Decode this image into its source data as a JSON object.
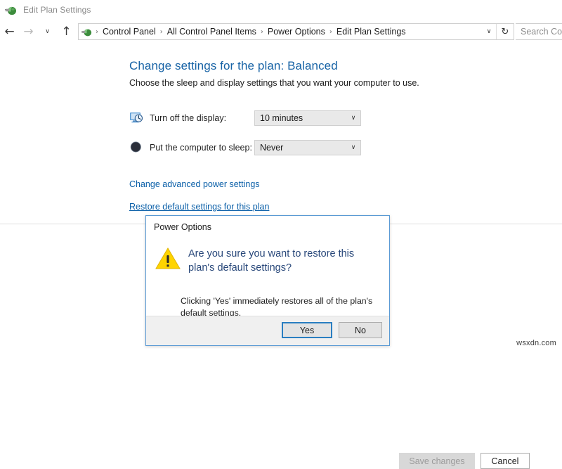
{
  "window": {
    "title": "Edit Plan Settings",
    "icon": "power-plug-icon"
  },
  "navbar": {
    "back_icon": "←",
    "forward_icon": "→",
    "recent_icon": "∨",
    "up_icon": "↑",
    "breadcrumb_icon": "power-plug-icon",
    "separator": "›",
    "breadcrumbs": [
      "Control Panel",
      "All Control Panel Items",
      "Power Options",
      "Edit Plan Settings"
    ],
    "address_dropdown_icon": "∨",
    "refresh_icon": "↻",
    "search_placeholder": "Search Cor"
  },
  "page": {
    "title": "Change settings for the plan: Balanced",
    "subtitle": "Choose the sleep and display settings that you want your computer to use.",
    "settings": [
      {
        "icon": "display-clock-icon",
        "label": "Turn off the display:",
        "value": "10 minutes",
        "chevron": "∨"
      },
      {
        "icon": "moon-sleep-icon",
        "label": "Put the computer to sleep:",
        "value": "Never",
        "chevron": "∨"
      }
    ],
    "links": [
      "Change advanced power settings",
      "Restore default settings for this plan"
    ]
  },
  "footer": {
    "save_label": "Save changes",
    "cancel_label": "Cancel",
    "watermark": "wsxdn.com"
  },
  "dialog": {
    "title": "Power Options",
    "icon": "warning-triangle-icon",
    "message": "Are you sure you want to restore this plan's default settings?",
    "detail": "Clicking 'Yes' immediately restores all of the plan's default settings.",
    "yes_label": "Yes",
    "no_label": "No"
  },
  "colors": {
    "accent_link": "#0a5fa8",
    "title_blue": "#1662a5",
    "dialog_border": "#5a9ad4",
    "warning_yellow": "#ffd400",
    "dialog_text_blue": "#29487a"
  }
}
